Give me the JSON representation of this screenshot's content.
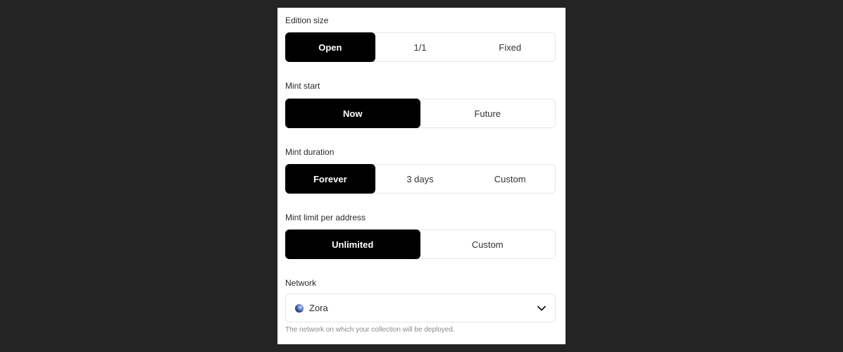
{
  "edition": {
    "label": "Edition size",
    "options": [
      "Open",
      "1/1",
      "Fixed"
    ],
    "selected": "Open"
  },
  "mint_start": {
    "label": "Mint start",
    "options": [
      "Now",
      "Future"
    ],
    "selected": "Now"
  },
  "mint_duration": {
    "label": "Mint duration",
    "options": [
      "Forever",
      "3 days",
      "Custom"
    ],
    "selected": "Forever"
  },
  "mint_limit": {
    "label": "Mint limit per address",
    "options": [
      "Unlimited",
      "Custom"
    ],
    "selected": "Unlimited"
  },
  "network": {
    "label": "Network",
    "value": "Zora",
    "icon": "globe-icon",
    "hint": "The network on which your collection will be deployed."
  },
  "colors": {
    "page_bg": "#242424",
    "panel_bg": "#ffffff",
    "active_bg": "#000000",
    "active_text": "#ffffff"
  }
}
